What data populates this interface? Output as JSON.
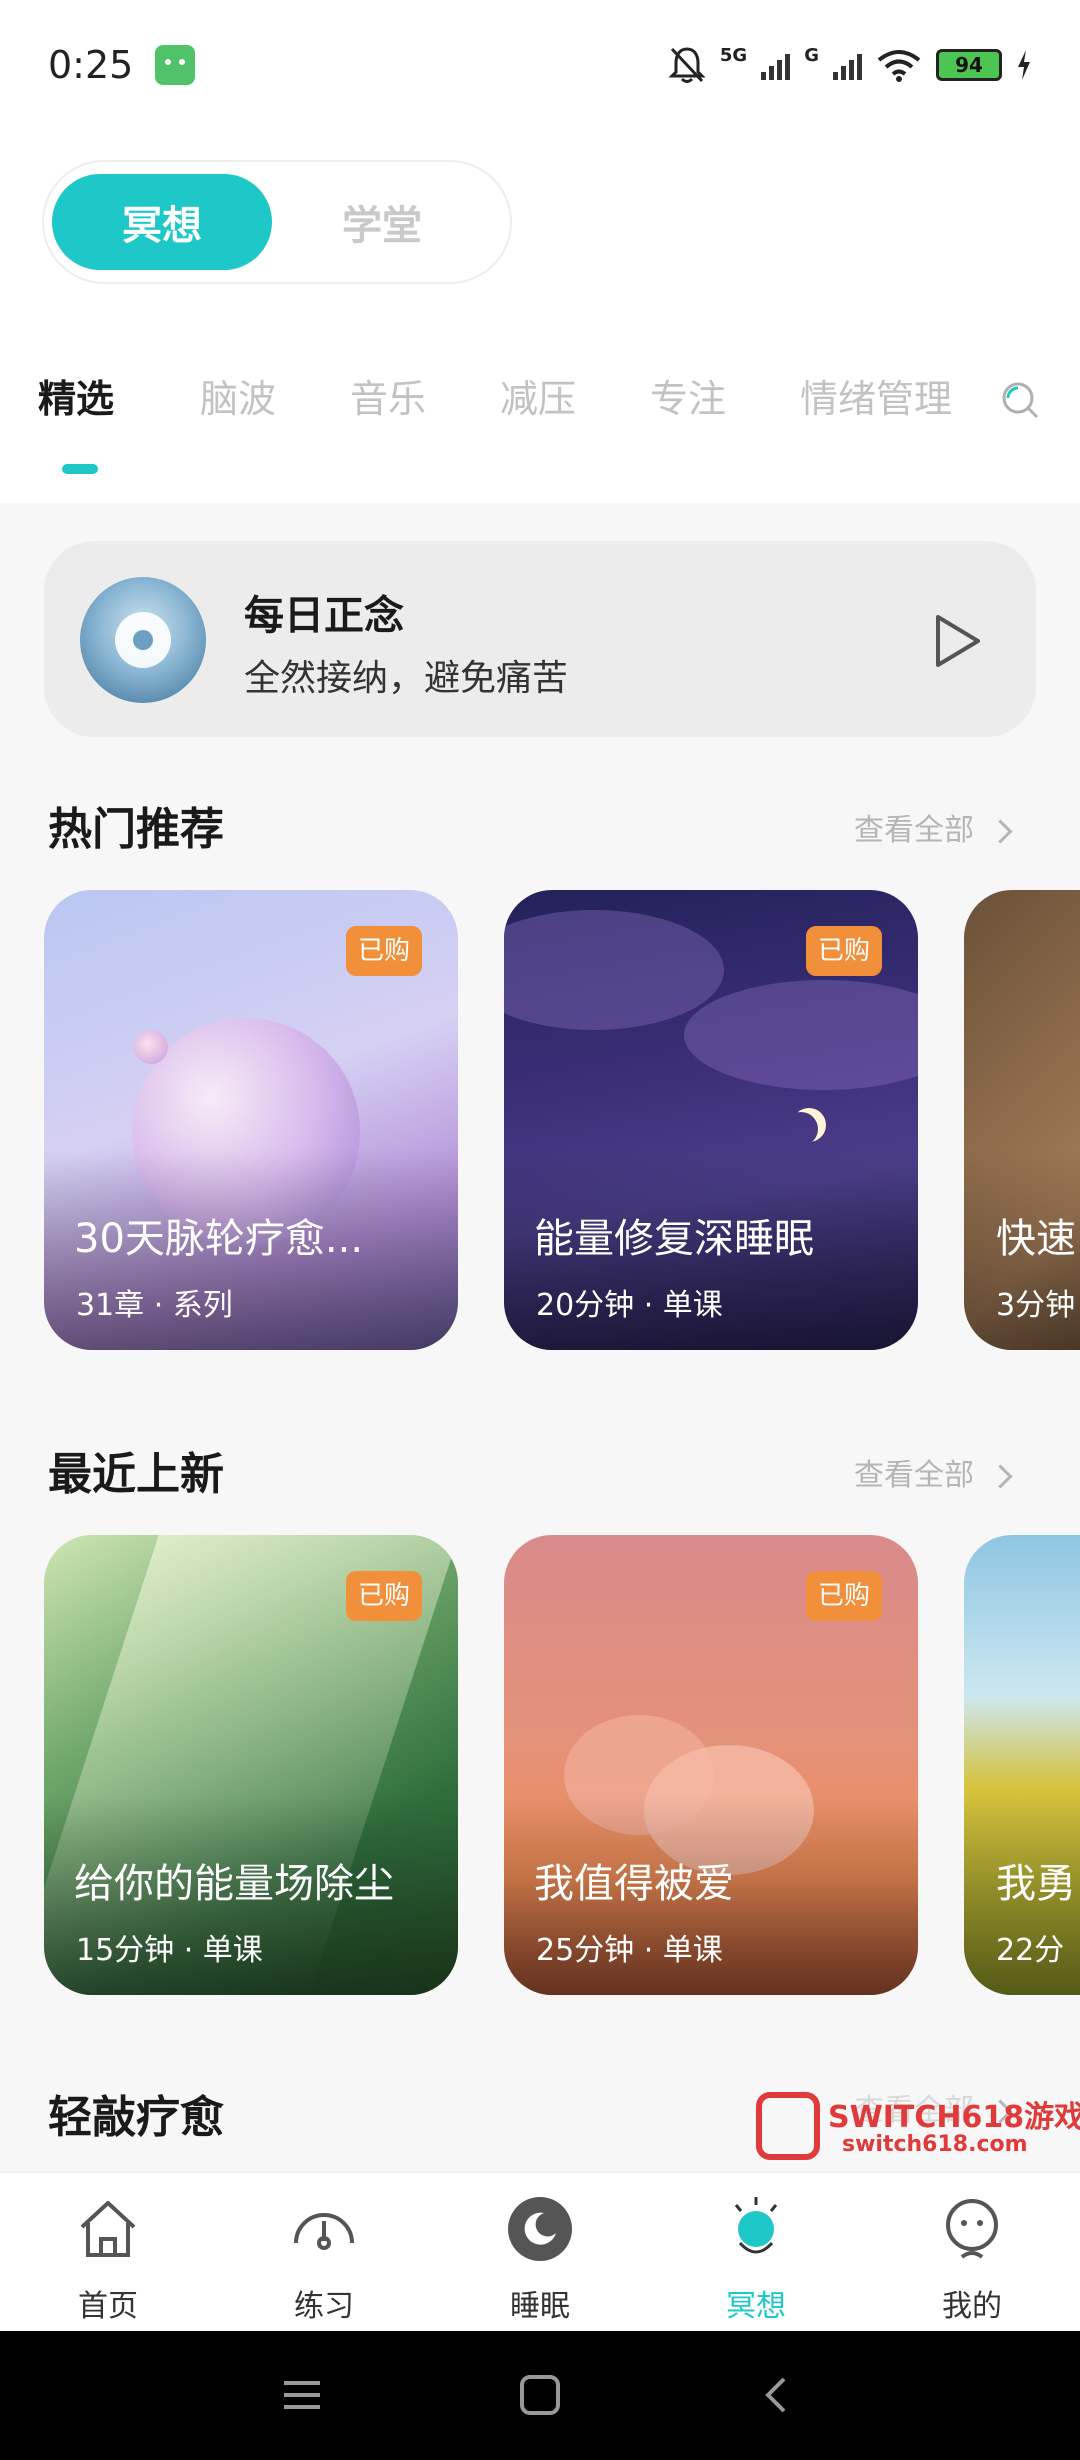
{
  "status_bar": {
    "time": "0:25",
    "network_5g": "5G",
    "network_g": "G",
    "battery": "94"
  },
  "mode_toggle": {
    "options": [
      "冥想",
      "学堂"
    ],
    "selected": "冥想"
  },
  "category_tabs": {
    "items": [
      "精选",
      "脑波",
      "音乐",
      "减压",
      "专注",
      "情绪管理"
    ],
    "selected": "精选"
  },
  "daily_mindfulness": {
    "title": "每日正念",
    "subtitle": "全然接纳，避免痛苦"
  },
  "sections": {
    "hot": {
      "title": "热门推荐",
      "see_all": "查看全部",
      "cards": [
        {
          "title": "30天脉轮疗愈...",
          "meta": "31章 · 系列",
          "badge": "已购"
        },
        {
          "title": "能量修复深睡眠",
          "meta": "20分钟 · 单课",
          "badge": "已购"
        },
        {
          "title": "快速",
          "meta": "3分钟"
        }
      ]
    },
    "new": {
      "title": "最近上新",
      "see_all": "查看全部",
      "cards": [
        {
          "title": "给你的能量场除尘",
          "meta": "15分钟 · 单课",
          "badge": "已购"
        },
        {
          "title": "我值得被爱",
          "meta": "25分钟 · 单课",
          "badge": "已购"
        },
        {
          "title": "我勇",
          "meta": "22分"
        }
      ]
    },
    "healing": {
      "title": "轻敲疗愈",
      "see_all": "查看全部"
    }
  },
  "bottom_nav": {
    "items": [
      {
        "label": "首页",
        "icon": "home-icon"
      },
      {
        "label": "练习",
        "icon": "gauge-icon"
      },
      {
        "label": "睡眠",
        "icon": "moon-icon"
      },
      {
        "label": "冥想",
        "icon": "meditation-icon"
      },
      {
        "label": "我的",
        "icon": "profile-icon"
      }
    ],
    "selected": "冥想",
    "accent_color": "#1ec8c8"
  },
  "watermark": {
    "line1": "SWITCH618游戏",
    "line2": "switch618.com"
  },
  "colors": {
    "accent": "#1ec8c8",
    "badge": "#f28f3b"
  }
}
